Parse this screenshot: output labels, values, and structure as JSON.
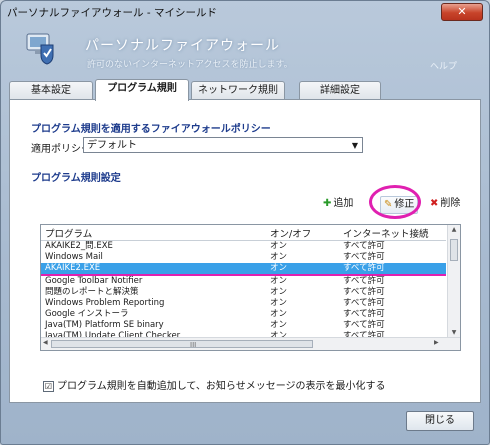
{
  "window": {
    "title": "パーソナルファイアウォール - マイシールド",
    "close_symbol": "✕"
  },
  "header": {
    "title": "パーソナルファイアウォール",
    "subtitle": "許可のないインターネットアクセスを防止します。",
    "help": "ヘルプ"
  },
  "tabs": [
    {
      "label": "基本設定"
    },
    {
      "label": "プログラム規則"
    },
    {
      "label": "ネットワーク規則"
    },
    {
      "label": "詳細設定"
    }
  ],
  "policy": {
    "section_title": "プログラム規則を適用するファイアウォールポリシー",
    "label": "適用ポリシー：",
    "value": "デフォルト"
  },
  "rules": {
    "section_title": "プログラム規則設定",
    "add_label": "追加",
    "edit_label": "修正",
    "delete_label": "削除"
  },
  "table": {
    "headers": [
      "プログラム",
      "オン/オフ",
      "インターネット接続"
    ],
    "rows": [
      [
        "AKAIKE2_問.EXE",
        "オン",
        "すべて許可"
      ],
      [
        "Windows Mail",
        "オン",
        "すべて許可"
      ],
      [
        "AKAIKE2.EXE",
        "オン",
        "すべて許可"
      ],
      [
        "Google Toolbar Notifier",
        "オン",
        "すべて許可"
      ],
      [
        "問題のレポートと解決策",
        "オン",
        "すべて許可"
      ],
      [
        "Windows Problem Reporting",
        "オン",
        "すべて許可"
      ],
      [
        "Google インストーラ",
        "オン",
        "すべて許可"
      ],
      [
        "Java(TM) Platform SE binary",
        "オン",
        "すべて許可"
      ],
      [
        "Java(TM) Update Client Checker",
        "オン",
        "すべて許可"
      ]
    ],
    "scroll_grip": "III"
  },
  "options": {
    "auto_add_label": "プログラム規則を自動追加して、お知らせメッセージの表示を最小化する",
    "auto_add_checked": "☑"
  },
  "footer": {
    "close_label": "閉じる"
  },
  "colors": {
    "selection": "#39a0e8",
    "highlight_annotation": "#e020b0",
    "section_title": "#1d3b8c"
  }
}
